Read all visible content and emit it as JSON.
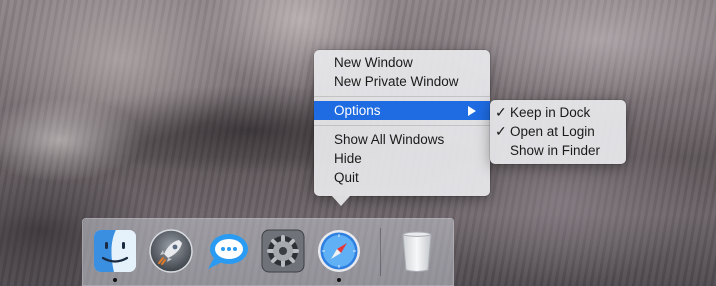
{
  "desktop": {
    "wallpaper": "granite-cliff"
  },
  "context_menu": {
    "items": [
      {
        "label": "New Window"
      },
      {
        "label": "New Private Window"
      },
      {
        "label": "Options",
        "highlighted": true,
        "has_submenu": true
      },
      {
        "label": "Show All Windows"
      },
      {
        "label": "Hide"
      },
      {
        "label": "Quit"
      }
    ],
    "highlight_color": "#1e6be2"
  },
  "options_submenu": {
    "items": [
      {
        "label": "Keep in Dock",
        "checked": true
      },
      {
        "label": "Open at Login",
        "checked": true
      },
      {
        "label": "Show in Finder",
        "checked": false
      }
    ],
    "check_glyph": "✓"
  },
  "dock": {
    "apps": [
      {
        "name": "Finder",
        "icon": "finder-icon",
        "running": true
      },
      {
        "name": "Launchpad",
        "icon": "rocket-icon",
        "running": false
      },
      {
        "name": "Messages",
        "icon": "speech-bubble-icon",
        "running": false
      },
      {
        "name": "System Preferences",
        "icon": "gear-icon",
        "running": false
      },
      {
        "name": "Safari",
        "icon": "compass-icon",
        "running": true
      },
      {
        "name": "Trash",
        "icon": "trash-icon",
        "running": false
      }
    ]
  }
}
